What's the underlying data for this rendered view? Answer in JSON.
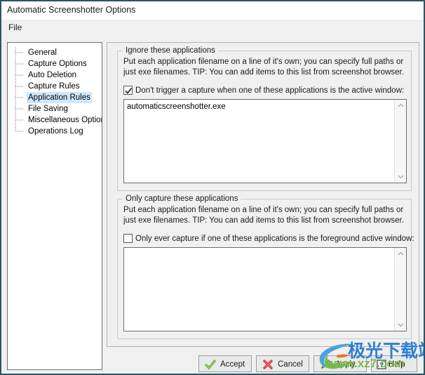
{
  "window": {
    "title": "Automatic Screenshotter Options",
    "border_color": "#2a5464",
    "background": "#f0f0f0"
  },
  "menubar": {
    "items": [
      {
        "label": "File"
      }
    ]
  },
  "sidebar": {
    "selected_index": 4,
    "highlight_color": "#cde8ff",
    "items": [
      {
        "label": "General"
      },
      {
        "label": "Capture Options"
      },
      {
        "label": "Auto Deletion"
      },
      {
        "label": "Capture Rules"
      },
      {
        "label": "Application Rules"
      },
      {
        "label": "File Saving"
      },
      {
        "label": "Miscellaneous Options"
      },
      {
        "label": "Operations Log"
      }
    ]
  },
  "main": {
    "groups": [
      {
        "title": "Ignore these applications",
        "description": "Put each application filename on a line of it's own; you can specify full paths or just exe filenames. TIP: You can add items to this list from screenshot browser.",
        "checkbox": {
          "label": "Don't trigger a capture when one of these applications is the active window:",
          "checked": true
        },
        "textarea": {
          "value": "automaticscreenshotter.exe",
          "placeholder": ""
        }
      },
      {
        "title": "Only capture these applications",
        "description": "Put each application filename on a line of it's own; you can specify full paths or just exe filenames. TIP: You can add items to this list from screenshot browser.",
        "checkbox": {
          "label": "Only ever capture if one of these applications is the foreground active window:",
          "checked": false
        },
        "textarea": {
          "value": "",
          "placeholder": ""
        }
      }
    ]
  },
  "footer": {
    "buttons": [
      {
        "label": "Accept",
        "icon": "green-check-icon"
      },
      {
        "label": "Cancel",
        "icon": "red-x-icon"
      },
      {
        "label": "Apply",
        "icon": "pencil-icon"
      },
      {
        "label": "Help",
        "icon": "question-mark-icon"
      }
    ]
  },
  "watermark": {
    "chinese_text": "极光下载站",
    "url_text": "www.xz7.com",
    "blue": "#2f7fd0",
    "green": "#7ab648"
  }
}
